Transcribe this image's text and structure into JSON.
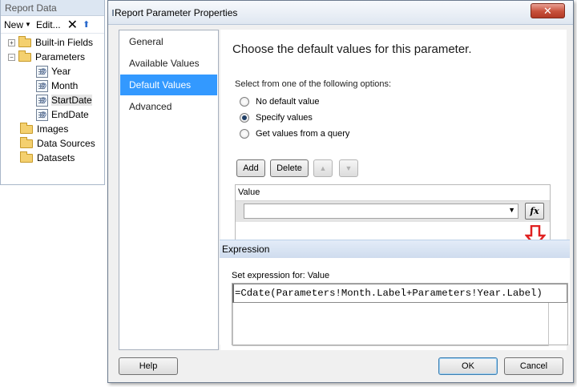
{
  "report_data": {
    "title": "Report Data",
    "toolbar": {
      "new_label": "New",
      "edit_label": "Edit...",
      "delete_icon": "x-icon",
      "up_icon": "arrow-up-icon"
    },
    "tree": [
      {
        "label": "Built-in Fields",
        "type": "folder",
        "expander": "+"
      },
      {
        "label": "Parameters",
        "type": "folder",
        "expander": "−"
      },
      {
        "label": "Year",
        "type": "parameter"
      },
      {
        "label": "Month",
        "type": "parameter"
      },
      {
        "label": "StartDate",
        "type": "parameter",
        "selected": true
      },
      {
        "label": "EndDate",
        "type": "parameter"
      },
      {
        "label": "Images",
        "type": "folder"
      },
      {
        "label": "Data Sources",
        "type": "folder"
      },
      {
        "label": "Datasets",
        "type": "folder"
      }
    ]
  },
  "dialog": {
    "title": "Report Parameter Properties",
    "close_label": "✕",
    "nav": [
      "General",
      "Available Values",
      "Default Values",
      "Advanced"
    ],
    "active_nav": "Default Values",
    "heading": "Choose the default values for this parameter.",
    "options_label": "Select from one of the following options:",
    "options": [
      {
        "label": "No default value",
        "checked": false
      },
      {
        "label": "Specify values",
        "checked": true
      },
      {
        "label": "Get values from a query",
        "checked": false
      }
    ],
    "buttons": {
      "add": "Add",
      "delete": "Delete",
      "up_arrow": "▲",
      "down_arrow": "▼"
    },
    "value_grid": {
      "header": "Value",
      "current_value": "",
      "dropdown_arrow": "▼",
      "fx_label": "fx"
    },
    "expression": {
      "title": "Expression",
      "set_label": "Set expression for: Value",
      "text": "=Cdate(Parameters!Month.Label+Parameters!Year.Label)"
    },
    "footer": {
      "help": "Help",
      "ok": "OK",
      "cancel": "Cancel"
    },
    "accent_color": "#3399ff",
    "arrow_color": "#e02020"
  }
}
